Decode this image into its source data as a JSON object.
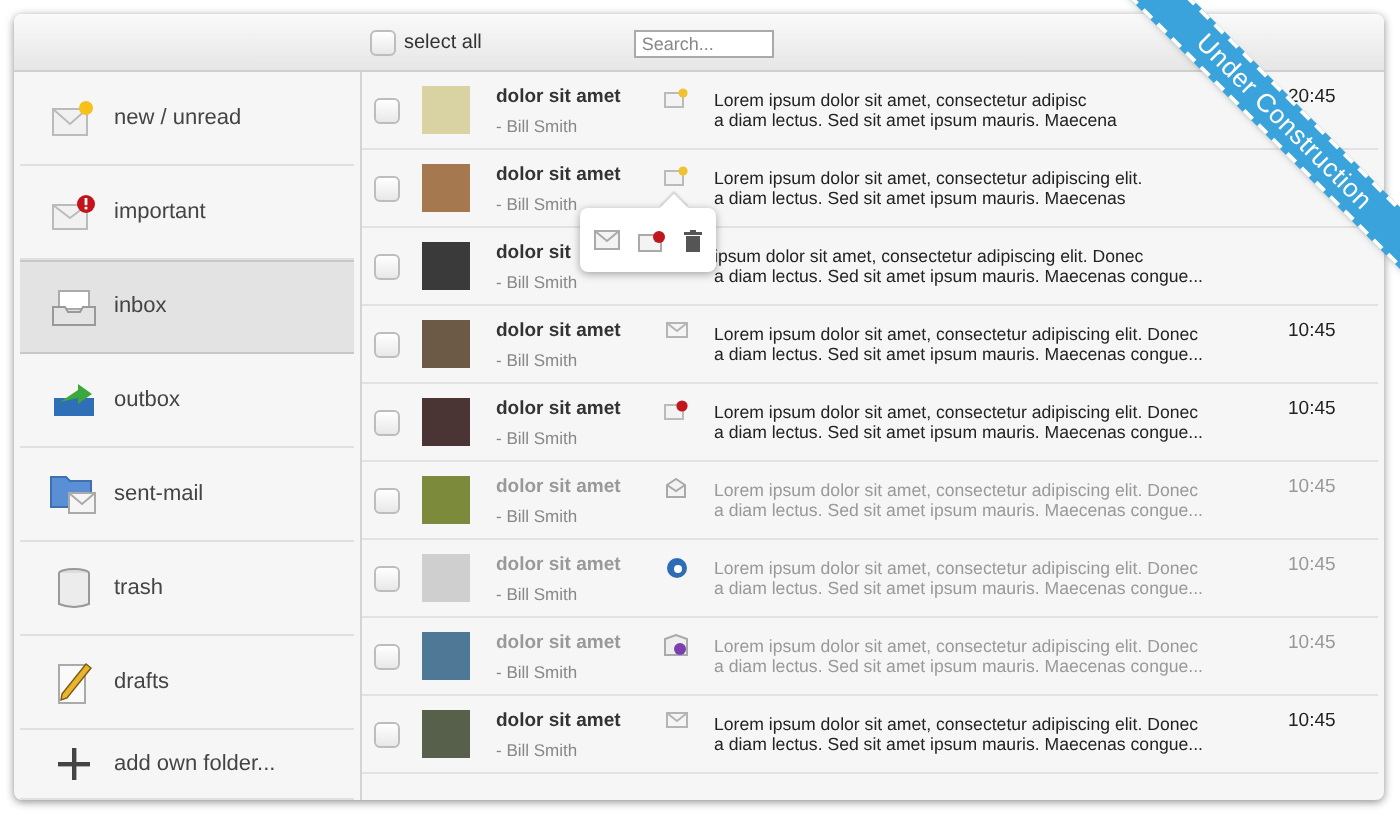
{
  "header": {
    "select_all": {
      "label": "select all",
      "checked": false
    },
    "search": {
      "placeholder": "Search..."
    }
  },
  "sidebar": {
    "items": [
      {
        "kind": "new",
        "label": "new / unread",
        "selected": false
      },
      {
        "kind": "important",
        "label": "important",
        "selected": false
      },
      {
        "kind": "inbox",
        "label": "inbox",
        "selected": true
      },
      {
        "kind": "outbox",
        "label": "outbox",
        "selected": false
      },
      {
        "kind": "sent",
        "label": "sent-mail",
        "selected": false
      },
      {
        "kind": "trash",
        "label": "trash",
        "selected": false
      },
      {
        "kind": "drafts",
        "label": "drafts",
        "selected": false
      },
      {
        "kind": "add",
        "label": "add own folder...",
        "selected": false
      }
    ]
  },
  "messages": [
    {
      "subject": "dolor sit amet",
      "sender": "- Bill Smith",
      "kind": "new",
      "unread": true,
      "checked": false,
      "preview": [
        "Lorem ipsum dolor sit amet, consectetur adipisc",
        "a diam lectus. Sed sit amet ipsum mauris. Maecena"
      ],
      "time": "20:45"
    },
    {
      "subject": "dolor sit amet",
      "sender": "- Bill Smith",
      "kind": "new",
      "unread": true,
      "checked": false,
      "preview": [
        "Lorem ipsum dolor sit amet, consectetur adipiscing elit.",
        "a diam lectus. Sed sit amet ipsum mauris. Maecenas"
      ]
    },
    {
      "subject": "dolor sit",
      "sender": "- Bill Smith",
      "kind": "none",
      "unread": true,
      "checked": false,
      "preview": [
        "ipsum dolor sit amet, consectetur adipiscing elit. Donec",
        "a diam lectus. Sed sit amet ipsum mauris. Maecenas congue..."
      ]
    },
    {
      "subject": "dolor sit amet",
      "sender": "- Bill Smith",
      "kind": "mail",
      "unread": true,
      "checked": false,
      "preview": [
        "Lorem ipsum dolor sit amet, consectetur adipiscing elit. Donec",
        "a diam lectus. Sed sit amet ipsum mauris. Maecenas congue..."
      ],
      "time": "10:45"
    },
    {
      "subject": "dolor sit amet",
      "sender": "- Bill Smith",
      "kind": "important",
      "unread": true,
      "checked": false,
      "preview": [
        "Lorem ipsum dolor sit amet, consectetur adipiscing elit. Donec",
        "a diam lectus. Sed sit amet ipsum mauris. Maecenas congue..."
      ],
      "time": "10:45"
    },
    {
      "subject": "dolor sit amet",
      "sender": "- Bill Smith",
      "kind": "opened",
      "unread": false,
      "checked": false,
      "preview": [
        "Lorem ipsum dolor sit amet, consectetur adipiscing elit. Donec",
        "a diam lectus. Sed sit amet ipsum mauris. Maecenas congue..."
      ],
      "time": "10:45"
    },
    {
      "subject": "dolor sit amet",
      "sender": "- Bill Smith",
      "kind": "sent",
      "unread": false,
      "checked": false,
      "preview": [
        "Lorem ipsum dolor sit amet, consectetur adipiscing elit. Donec",
        "a diam lectus. Sed sit amet ipsum mauris. Maecenas congue..."
      ],
      "time": "10:45"
    },
    {
      "subject": "dolor sit amet",
      "sender": "- Bill Smith",
      "kind": "outbox",
      "unread": false,
      "checked": false,
      "preview": [
        "Lorem ipsum dolor sit amet, consectetur adipiscing elit. Donec",
        "a diam lectus. Sed sit amet ipsum mauris. Maecenas congue..."
      ],
      "time": "10:45"
    },
    {
      "subject": "dolor sit amet",
      "sender": "- Bill Smith",
      "kind": "mail",
      "unread": true,
      "checked": false,
      "preview": [
        "Lorem ipsum dolor sit amet, consectetur adipiscing elit. Donec",
        "a diam lectus. Sed sit amet ipsum mauris. Maecenas congue..."
      ],
      "time": "10:45"
    }
  ],
  "ribbon": {
    "text": "Under Construction"
  }
}
